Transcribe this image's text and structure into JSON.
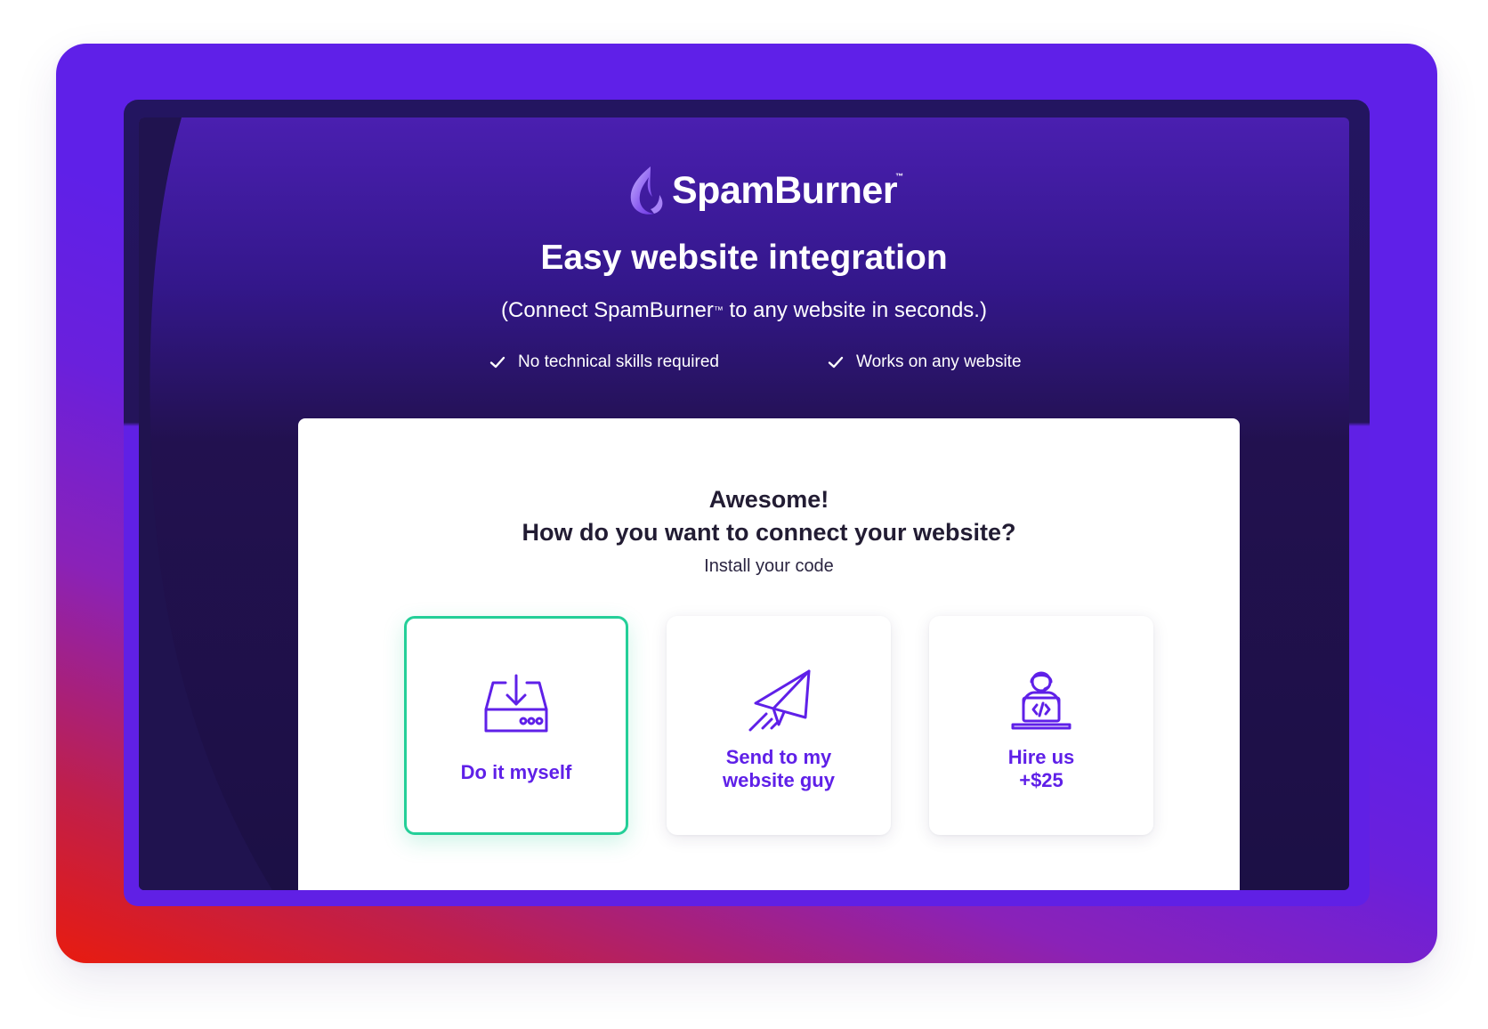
{
  "brand": {
    "name": "SpamBurner",
    "trademark": "™",
    "colors": {
      "primary": "#5f20e8",
      "accent_selected": "#24cf98",
      "dark_bg": "#22114f"
    }
  },
  "header": {
    "title": "Easy website integration",
    "subtitle_before": "(Connect SpamBurner",
    "subtitle_tm": "™",
    "subtitle_after": " to any website in seconds.)",
    "features": [
      {
        "icon": "check-icon",
        "label": "No technical skills required"
      },
      {
        "icon": "check-icon",
        "label": "Works on any website"
      }
    ]
  },
  "card": {
    "title_line1": "Awesome!",
    "title_line2": "How do you want to connect your website?",
    "subtitle": "Install your code",
    "options": [
      {
        "icon": "download-drive-icon",
        "label_line1": "Do it myself",
        "label_line2": "",
        "selected": true
      },
      {
        "icon": "paper-plane-icon",
        "label_line1": "Send to my",
        "label_line2": "website guy",
        "selected": false
      },
      {
        "icon": "developer-laptop-icon",
        "label_line1": "Hire us",
        "label_line2": "+$25",
        "selected": false
      }
    ]
  }
}
